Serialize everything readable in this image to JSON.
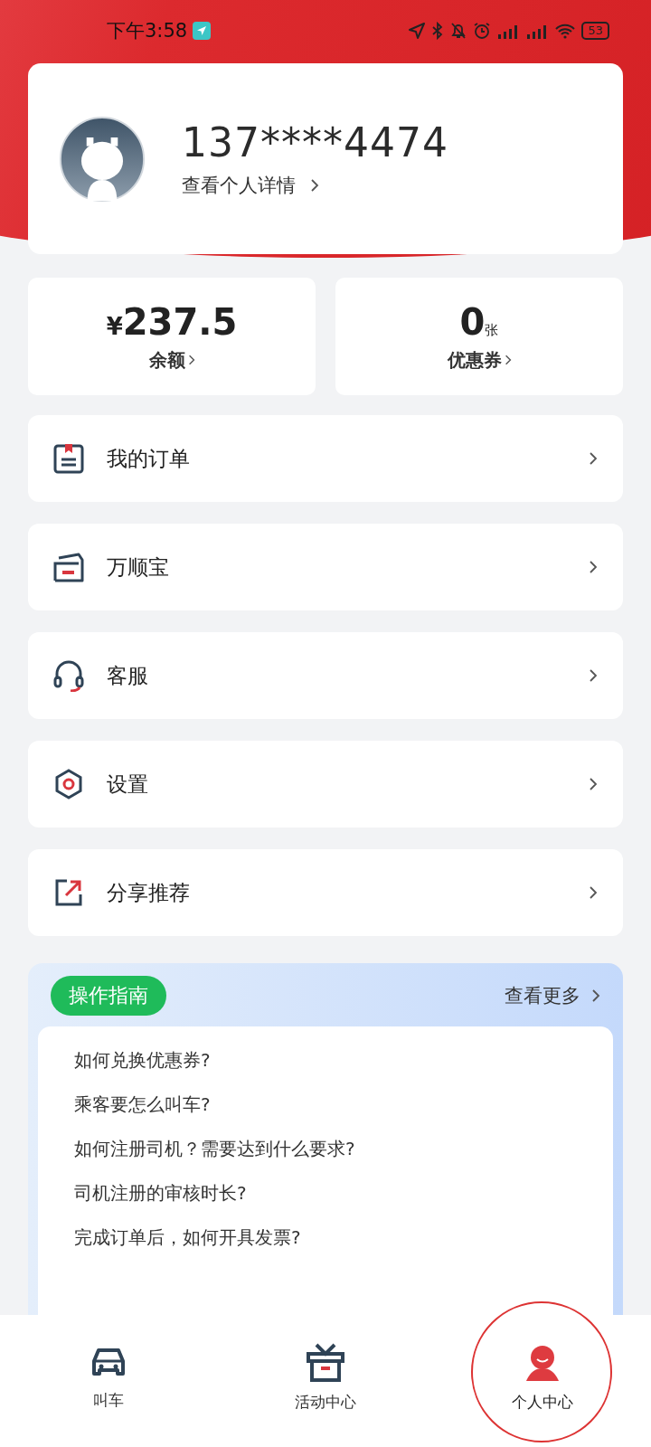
{
  "status_bar": {
    "time": "下午3:58",
    "battery": "53"
  },
  "profile": {
    "phone": "137****4474",
    "details_link": "查看个人详情"
  },
  "stats": [
    {
      "kind": "money",
      "currency": "¥",
      "value": "237.5",
      "label": "余额"
    },
    {
      "kind": "count",
      "value": "0",
      "unit": "张",
      "label": "优惠券"
    }
  ],
  "menu": [
    {
      "kind": "orders",
      "label": "我的订单"
    },
    {
      "kind": "wallet",
      "label": "万顺宝"
    },
    {
      "kind": "service",
      "label": "客服"
    },
    {
      "kind": "settings",
      "label": "设置"
    },
    {
      "kind": "share",
      "label": "分享推荐"
    }
  ],
  "guide": {
    "badge": "操作指南",
    "more": "查看更多",
    "questions": [
      "如何兑换优惠券?",
      "乘客要怎么叫车?",
      "如何注册司机？需要达到什么要求?",
      "司机注册的审核时长?",
      "完成订单后，如何开具发票?"
    ]
  },
  "tab_bar": [
    {
      "kind": "car",
      "label": "叫车",
      "selected": false,
      "highlighted": false
    },
    {
      "kind": "gift",
      "label": "活动中心",
      "selected": false,
      "highlighted": false
    },
    {
      "kind": "person",
      "label": "个人中心",
      "selected": true,
      "highlighted": true
    }
  ]
}
